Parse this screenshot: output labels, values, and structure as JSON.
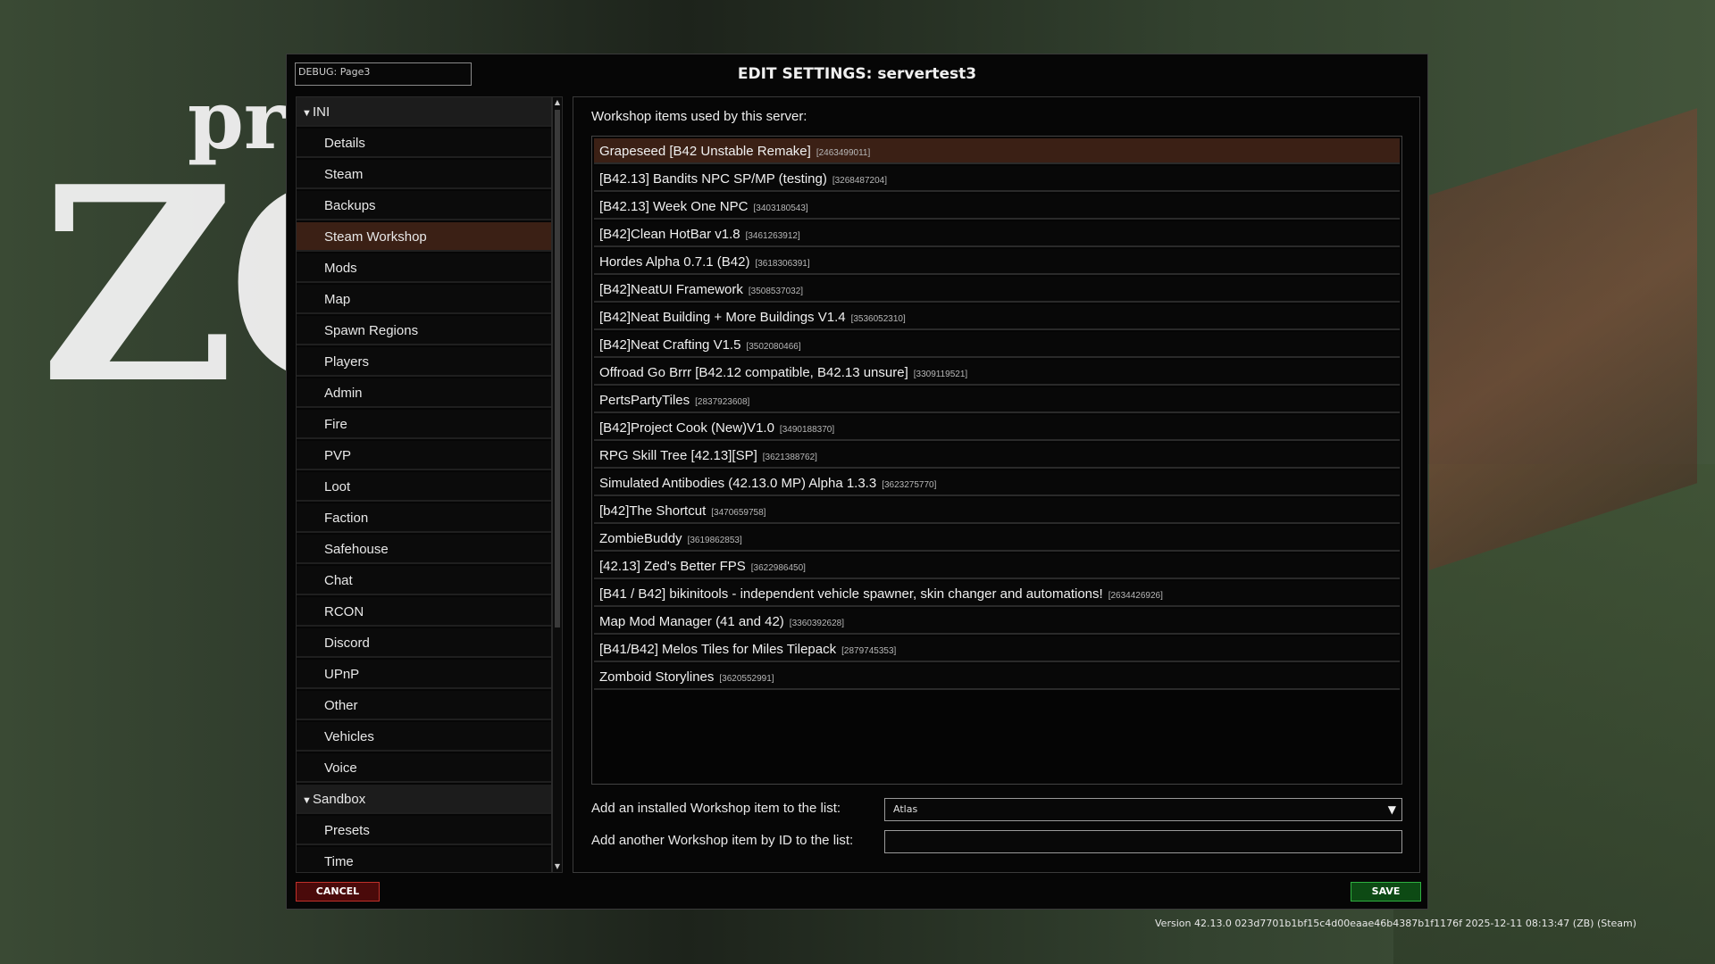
{
  "background": {
    "logo_small": "pr",
    "logo_big": "ZOM"
  },
  "dialog": {
    "debug_text": "DEBUG: Page3",
    "title": "EDIT SETTINGS: servertest3"
  },
  "nav": {
    "items": [
      {
        "label": "INI",
        "type": "group"
      },
      {
        "label": "Details",
        "type": "item"
      },
      {
        "label": "Steam",
        "type": "item"
      },
      {
        "label": "Backups",
        "type": "item"
      },
      {
        "label": "Steam Workshop",
        "type": "item",
        "selected": true
      },
      {
        "label": "Mods",
        "type": "item"
      },
      {
        "label": "Map",
        "type": "item"
      },
      {
        "label": "Spawn Regions",
        "type": "item"
      },
      {
        "label": "Players",
        "type": "item"
      },
      {
        "label": "Admin",
        "type": "item"
      },
      {
        "label": "Fire",
        "type": "item"
      },
      {
        "label": "PVP",
        "type": "item"
      },
      {
        "label": "Loot",
        "type": "item"
      },
      {
        "label": "Faction",
        "type": "item"
      },
      {
        "label": "Safehouse",
        "type": "item"
      },
      {
        "label": "Chat",
        "type": "item"
      },
      {
        "label": "RCON",
        "type": "item"
      },
      {
        "label": "Discord",
        "type": "item"
      },
      {
        "label": "UPnP",
        "type": "item"
      },
      {
        "label": "Other",
        "type": "item"
      },
      {
        "label": "Vehicles",
        "type": "item"
      },
      {
        "label": "Voice",
        "type": "item"
      },
      {
        "label": "Sandbox",
        "type": "group"
      },
      {
        "label": "Presets",
        "type": "item"
      },
      {
        "label": "Time",
        "type": "item"
      }
    ]
  },
  "workshop": {
    "heading": "Workshop items used by this server:",
    "items": [
      {
        "name": "Grapeseed [B42 Unstable Remake]",
        "id": "[2463499011]",
        "selected": true
      },
      {
        "name": "[B42.13] Bandits NPC SP/MP (testing)",
        "id": "[3268487204]"
      },
      {
        "name": "[B42.13] Week One NPC",
        "id": "[3403180543]"
      },
      {
        "name": "[B42]Clean HotBar v1.8",
        "id": "[3461263912]"
      },
      {
        "name": "Hordes Alpha 0.7.1 (B42)",
        "id": "[3618306391]"
      },
      {
        "name": "[B42]NeatUI Framework",
        "id": "[3508537032]"
      },
      {
        "name": "[B42]Neat Building + More Buildings V1.4",
        "id": "[3536052310]"
      },
      {
        "name": "[B42]Neat Crafting V1.5",
        "id": "[3502080466]"
      },
      {
        "name": "Offroad Go Brrr [B42.12 compatible, B42.13 unsure]",
        "id": "[3309119521]"
      },
      {
        "name": "PertsPartyTiles",
        "id": "[2837923608]"
      },
      {
        "name": "[B42]Project Cook (New)V1.0",
        "id": "[3490188370]"
      },
      {
        "name": "RPG Skill Tree [42.13][SP]",
        "id": "[3621388762]"
      },
      {
        "name": "Simulated Antibodies (42.13.0 MP) Alpha 1.3.3",
        "id": "[3623275770]"
      },
      {
        "name": "[b42]The Shortcut",
        "id": "[3470659758]"
      },
      {
        "name": "ZombieBuddy",
        "id": "[3619862853]"
      },
      {
        "name": "[42.13] Zed's Better FPS",
        "id": "[3622986450]"
      },
      {
        "name": "[B41 / B42] bikinitools - independent vehicle spawner, skin changer and automations!",
        "id": "[2634426926]"
      },
      {
        "name": "Map Mod Manager (41 and 42)",
        "id": "[3360392628]"
      },
      {
        "name": "[B41/B42] Melos Tiles for Miles Tilepack",
        "id": "[2879745353]"
      },
      {
        "name": "Zomboid Storylines",
        "id": "[3620552991]"
      }
    ],
    "add_installed_label": "Add an installed Workshop item to the list:",
    "add_installed_value": "Atlas",
    "add_by_id_label": "Add another Workshop item by ID to the list:",
    "add_by_id_value": ""
  },
  "buttons": {
    "cancel": "CANCEL",
    "save": "SAVE"
  },
  "version_text": "Version 42.13.0 023d7701b1bf15c4d00eaae46b4387b1f1176f 2025-12-11 08:13:47 (ZB) (Steam)",
  "colors": {
    "selected_row": "#3b2015",
    "cancel_border": "#c0302a",
    "save_border": "#2fb040"
  }
}
